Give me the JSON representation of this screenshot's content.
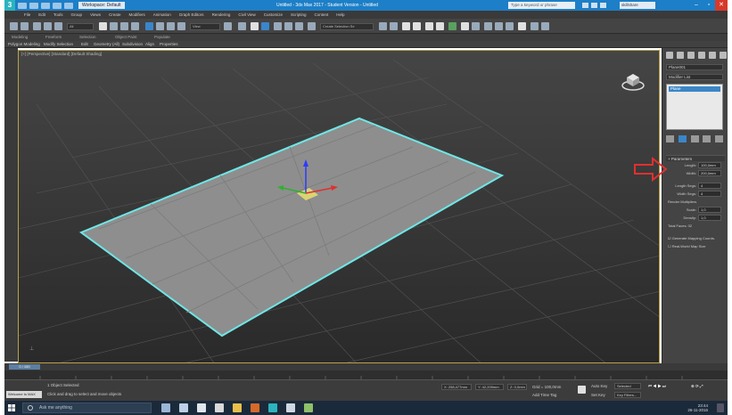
{
  "titlebar": {
    "workspace": "Workspace: Default",
    "title": "Untitled - 3ds Max 2017 - Student Version - Untitled",
    "search_placeholder": "Type a keyword or phrase",
    "user": "skillshare"
  },
  "menu": [
    "File",
    "Edit",
    "Tools",
    "Group",
    "Views",
    "Create",
    "Modifiers",
    "Animation",
    "Graph Editors",
    "Rendering",
    "Civil View",
    "Customize",
    "Scripting",
    "Content",
    "Help"
  ],
  "toolbar": {
    "selection_filter": "All",
    "named_selection": "Create Selection Se",
    "view_dropdown": "View"
  },
  "ribbon": {
    "tabs": [
      "Modeling",
      "Freeform",
      "Selection",
      "Object Paint",
      "Populate"
    ],
    "subtabs": [
      "Polygon Modeling",
      "Modify Selection",
      "Edit",
      "Geometry (All)",
      "Subdivision",
      "Align",
      "Properties"
    ]
  },
  "viewport": {
    "label": "[+] [Perspective] [Standard] [Default Shading]"
  },
  "command_panel": {
    "object_name": "Plane001",
    "modifier_list_label": "Modifier List",
    "stack_item": "Plane",
    "rollout_title": "Parameters",
    "length_label": "Length:",
    "length_value": "100,0mm",
    "width_label": "Width:",
    "width_value": "200,0mm",
    "length_segs_label": "Length Segs:",
    "length_segs_value": "4",
    "width_segs_label": "Width Segs:",
    "width_segs_value": "4",
    "render_mult_label": "Render Multipliers",
    "scale_label": "Scale:",
    "scale_value": "1,0",
    "density_label": "Density:",
    "density_value": "1,0",
    "total_faces": "Total Faces: 32",
    "gen_mapping": "Generate Mapping Coords.",
    "real_world": "Real-World Map Size"
  },
  "timeline": {
    "frame": "0 / 100"
  },
  "statusbar": {
    "maxscript": "Welcome to MAX",
    "selection": "1 Object Selected",
    "prompt": "Click and drag to select and move objects",
    "x": "X: 258,477mm",
    "y": "Y: 42,209mm",
    "z": "Z: 0,0mm",
    "grid": "Grid = 100,0mm",
    "add_time_tag": "Add Time Tag",
    "auto_key": "Auto Key",
    "set_key": "Set Key",
    "selected": "Selected",
    "key_filters": "Key Filters..."
  },
  "taskbar": {
    "search_placeholder": "Ask me anything",
    "time": "23:44",
    "date": "26-11-2016"
  },
  "colors": {
    "title_blue": "#1d7fc7",
    "plane_fill": "#8e8e8e",
    "plane_edge": "#6fe6e6",
    "highlight_arrow": "#e03030"
  }
}
